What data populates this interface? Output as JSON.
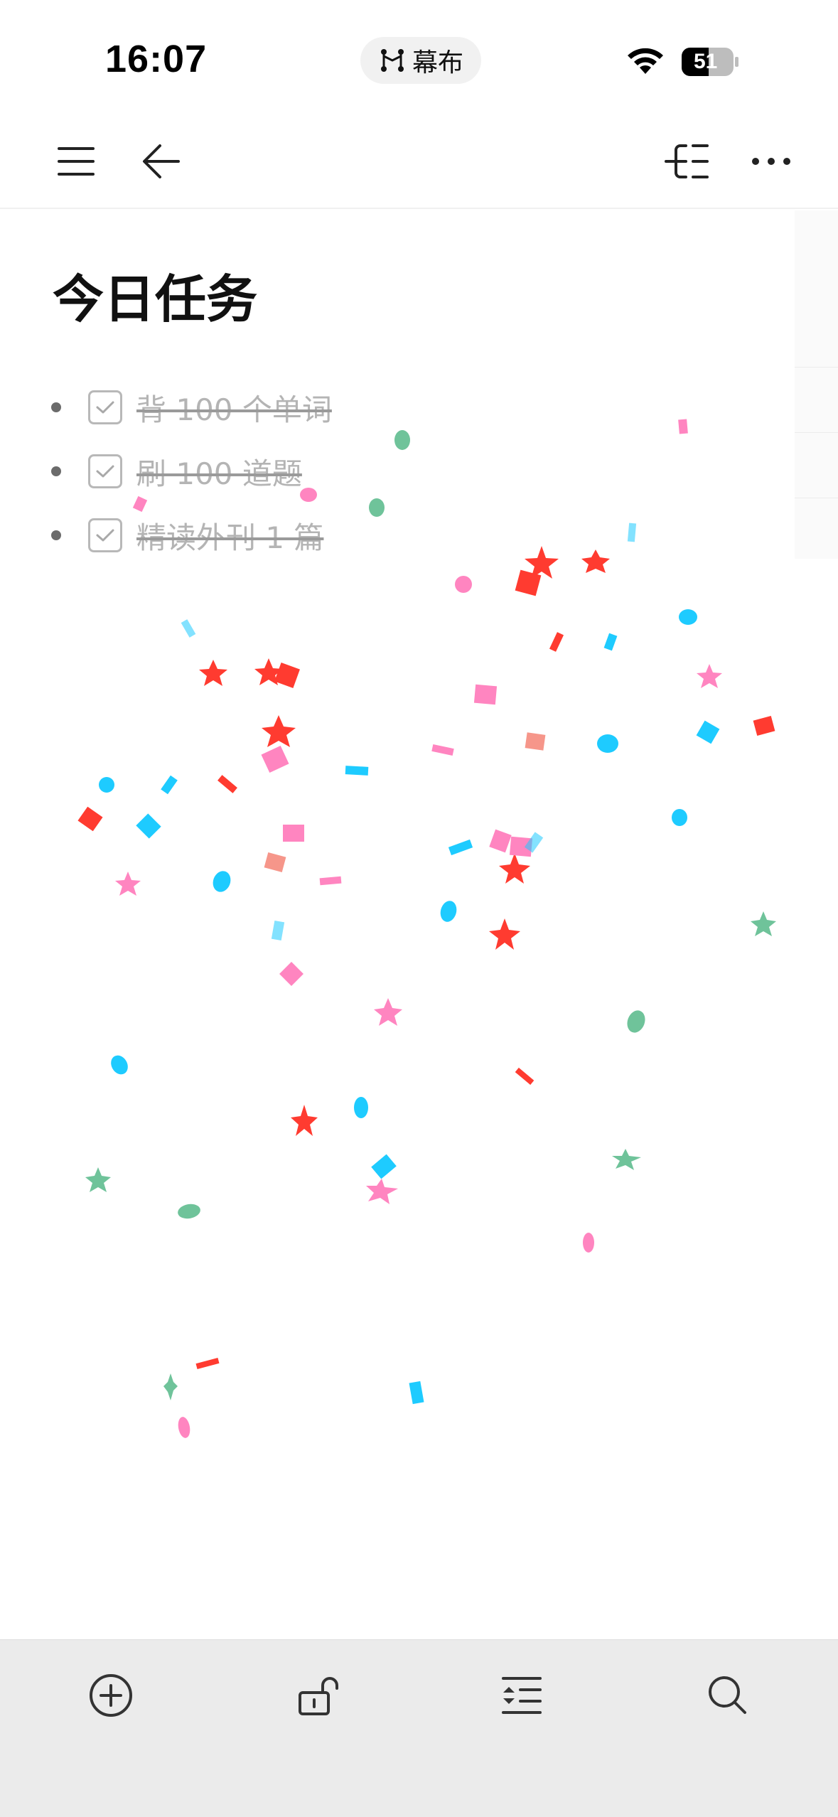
{
  "status_bar": {
    "time": "16:07",
    "island_label": "幕布",
    "battery_level": "51"
  },
  "toolbar": {
    "menu_icon": "hamburger-menu-icon",
    "back_icon": "arrow-left-icon",
    "mindmap_icon": "mind-map-icon",
    "more_icon": "more-horizontal-icon"
  },
  "document": {
    "title": "今日任务",
    "tasks": [
      {
        "text": "背 100 个单词",
        "completed": true
      },
      {
        "text": "刷 100 道题",
        "completed": true
      },
      {
        "text": "精读外刊 1 篇",
        "completed": true
      }
    ]
  },
  "bottom_bar": {
    "items": [
      {
        "icon": "add-circle-icon"
      },
      {
        "icon": "unlock-icon"
      },
      {
        "icon": "indent-outdent-icon"
      },
      {
        "icon": "search-icon"
      }
    ]
  },
  "colors": {
    "confetti_red": "#ff3b30",
    "confetti_pink": "#ff85c0",
    "confetti_cyan": "#1ecbff",
    "confetti_green": "#6fc39a",
    "bottom_bar_bg": "#ebebeb",
    "completed_text": "#b4b4b4"
  }
}
